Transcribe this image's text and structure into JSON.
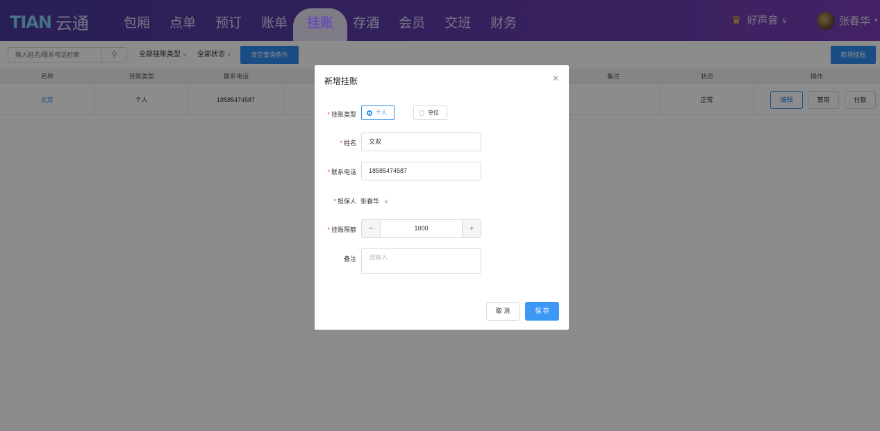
{
  "app": {
    "logo_mark": "TIAN",
    "logo_text": "云通"
  },
  "nav": {
    "items": [
      {
        "label": "包厢"
      },
      {
        "label": "点单"
      },
      {
        "label": "预订"
      },
      {
        "label": "账单"
      },
      {
        "label": "挂账"
      },
      {
        "label": "存酒"
      },
      {
        "label": "会员"
      },
      {
        "label": "交班"
      },
      {
        "label": "财务"
      }
    ],
    "active": "挂账"
  },
  "header": {
    "store": "好声音",
    "user": "张春华"
  },
  "toolbar": {
    "search_placeholder": "输入姓名/联系电话检索",
    "type_filter": "全部挂账类型",
    "status_filter": "全部状态",
    "clear_label": "清空查询条件",
    "add_label": "新增挂账"
  },
  "table": {
    "columns": [
      "名称",
      "挂账类型",
      "联系电话",
      "备注",
      "状态",
      "操作"
    ],
    "rows": [
      {
        "name": "文双",
        "type": "个人",
        "phone": "18585474587",
        "status": "正常",
        "actions": [
          "编辑",
          "禁用",
          "付款"
        ]
      }
    ]
  },
  "modal": {
    "title": "新增挂账",
    "type_label": "挂账类型",
    "type_options": [
      "个人",
      "单位"
    ],
    "type_selected": "个人",
    "name_label": "姓名",
    "name_value": "文双",
    "phone_label": "联系电话",
    "phone_value": "18585474587",
    "guarantor_label": "担保人",
    "guarantor_value": "张春华",
    "limit_label": "挂账限额",
    "limit_value": "1000",
    "remark_label": "备注",
    "remark_placeholder": "请输入",
    "cancel_label": "取 消",
    "save_label": "保 存"
  },
  "colors": {
    "header_start": "#4b3a9e",
    "header_end": "#7a3fb8",
    "primary": "#2f8cf0",
    "required": "#e33333"
  },
  "icons": [
    "search-icon",
    "chevron-down-icon",
    "crown-icon",
    "close-icon",
    "minus-icon",
    "plus-icon"
  ]
}
